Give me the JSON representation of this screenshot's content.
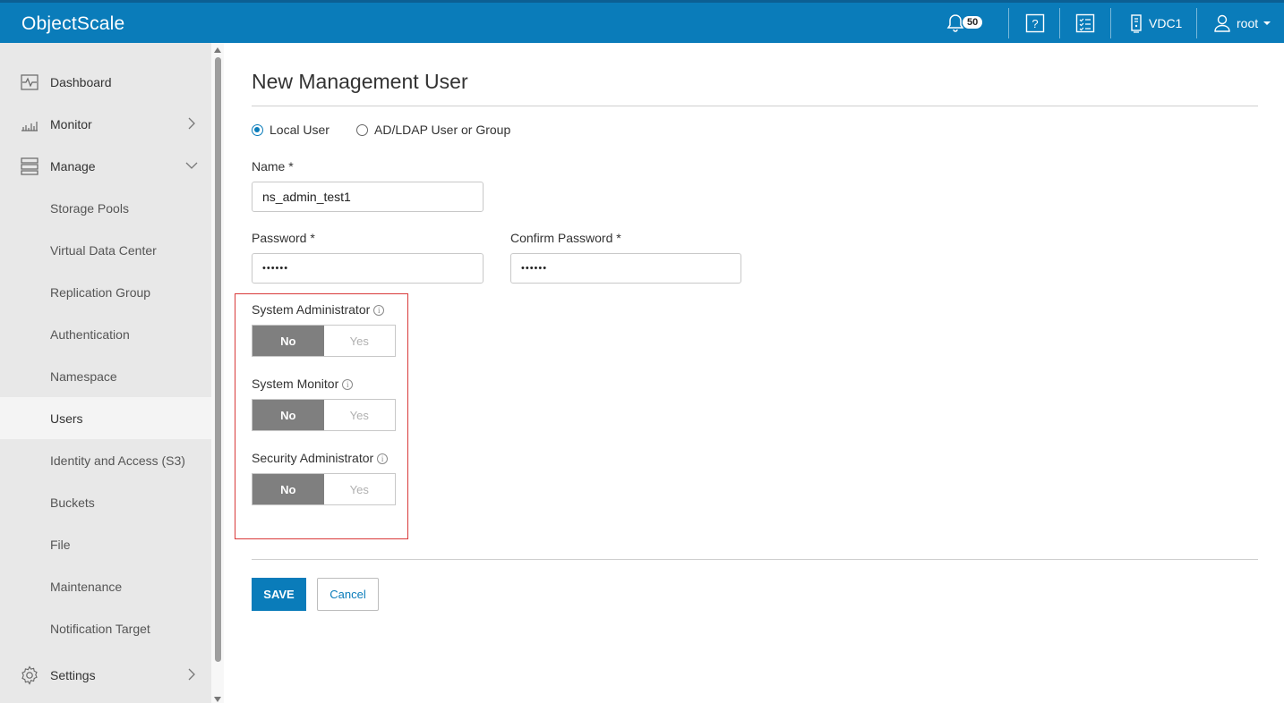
{
  "header": {
    "brand": "ObjectScale",
    "notifications_count": "50",
    "vdc_label": "VDC1",
    "user_label": "root",
    "color": "#0a7cba"
  },
  "sidebar": {
    "items": [
      {
        "label": "Dashboard",
        "icon": "dashboard-icon"
      },
      {
        "label": "Monitor",
        "icon": "monitor-icon"
      },
      {
        "label": "Manage",
        "icon": "manage-icon"
      },
      {
        "label": "Storage Pools"
      },
      {
        "label": "Virtual Data Center"
      },
      {
        "label": "Replication Group"
      },
      {
        "label": "Authentication"
      },
      {
        "label": "Namespace"
      },
      {
        "label": "Users",
        "active": true
      },
      {
        "label": "Identity and Access (S3)"
      },
      {
        "label": "Buckets"
      },
      {
        "label": "File"
      },
      {
        "label": "Maintenance"
      },
      {
        "label": "Notification Target"
      },
      {
        "label": "Settings",
        "icon": "settings-icon"
      }
    ]
  },
  "form": {
    "title": "New Management User",
    "user_type": {
      "options": [
        "Local User",
        "AD/LDAP User or Group"
      ],
      "selected": "Local User"
    },
    "name_label": "Name *",
    "name_value": "ns_admin_test1",
    "password_label": "Password *",
    "password_value": "••••••",
    "confirm_label": "Confirm Password *",
    "confirm_value": "••••••",
    "roles": [
      {
        "label": "System Administrator",
        "no": "No",
        "yes": "Yes",
        "value": "No"
      },
      {
        "label": "System Monitor",
        "no": "No",
        "yes": "Yes",
        "value": "No"
      },
      {
        "label": "Security Administrator",
        "no": "No",
        "yes": "Yes",
        "value": "No"
      }
    ],
    "save_label": "SAVE",
    "cancel_label": "Cancel"
  }
}
